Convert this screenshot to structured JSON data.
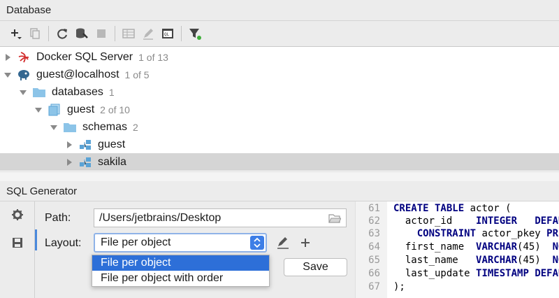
{
  "database_panel": {
    "title": "Database"
  },
  "toolbar": {
    "buttons": [
      "add-icon",
      "duplicate-icon",
      "refresh-icon",
      "db-settings-icon",
      "stop-icon",
      "table-icon",
      "edit-icon",
      "sql-console-icon",
      "filter-icon"
    ]
  },
  "tree": {
    "items": [
      {
        "label": "Docker SQL Server",
        "count": "1 of 13"
      },
      {
        "label": "guest@localhost",
        "count": "1 of 5"
      },
      {
        "label": "databases",
        "count": "1"
      },
      {
        "label": "guest",
        "count": "2 of 10"
      },
      {
        "label": "schemas",
        "count": "2"
      },
      {
        "label": "guest",
        "count": ""
      },
      {
        "label": "sakila",
        "count": ""
      }
    ]
  },
  "sql_generator": {
    "title": "SQL Generator",
    "path_label": "Path:",
    "path_value": "/Users/jetbrains/Desktop",
    "layout_label": "Layout:",
    "layout_value": "File per object",
    "layout_options": [
      "File per object",
      "File per object with order"
    ],
    "save_label": "Save"
  },
  "code": {
    "line_numbers": [
      "61",
      "62",
      "63",
      "64",
      "65",
      "66",
      "67"
    ]
  },
  "colors": {
    "accent": "#2d6fd8",
    "selection": "#d5d5d5",
    "keyword": "#000080"
  }
}
